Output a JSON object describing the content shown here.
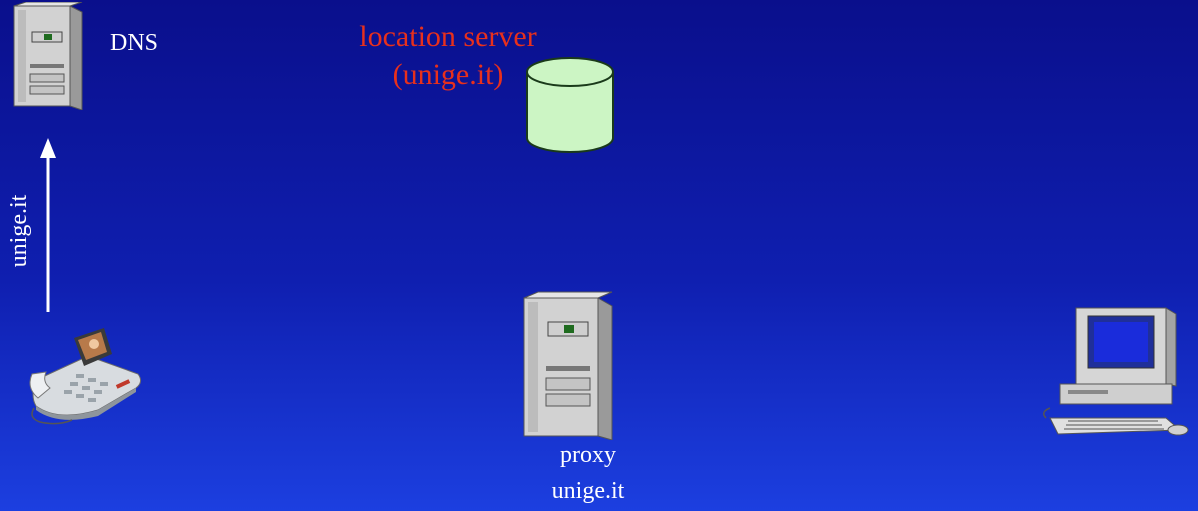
{
  "dns": {
    "label": "DNS"
  },
  "location_server": {
    "line1": "location server",
    "line2": "(unige.it)"
  },
  "arrow": {
    "label": "unige.it"
  },
  "proxy": {
    "line1": "proxy",
    "line2": "unige.it"
  },
  "colors": {
    "background_top": "#0a0f8c",
    "background_bottom": "#1c3fe0",
    "accent_red": "#e8301c",
    "db_fill": "#ccf5c4"
  },
  "icons": [
    "server-tower-icon",
    "database-cylinder-icon",
    "video-phone-icon",
    "desktop-computer-icon"
  ]
}
